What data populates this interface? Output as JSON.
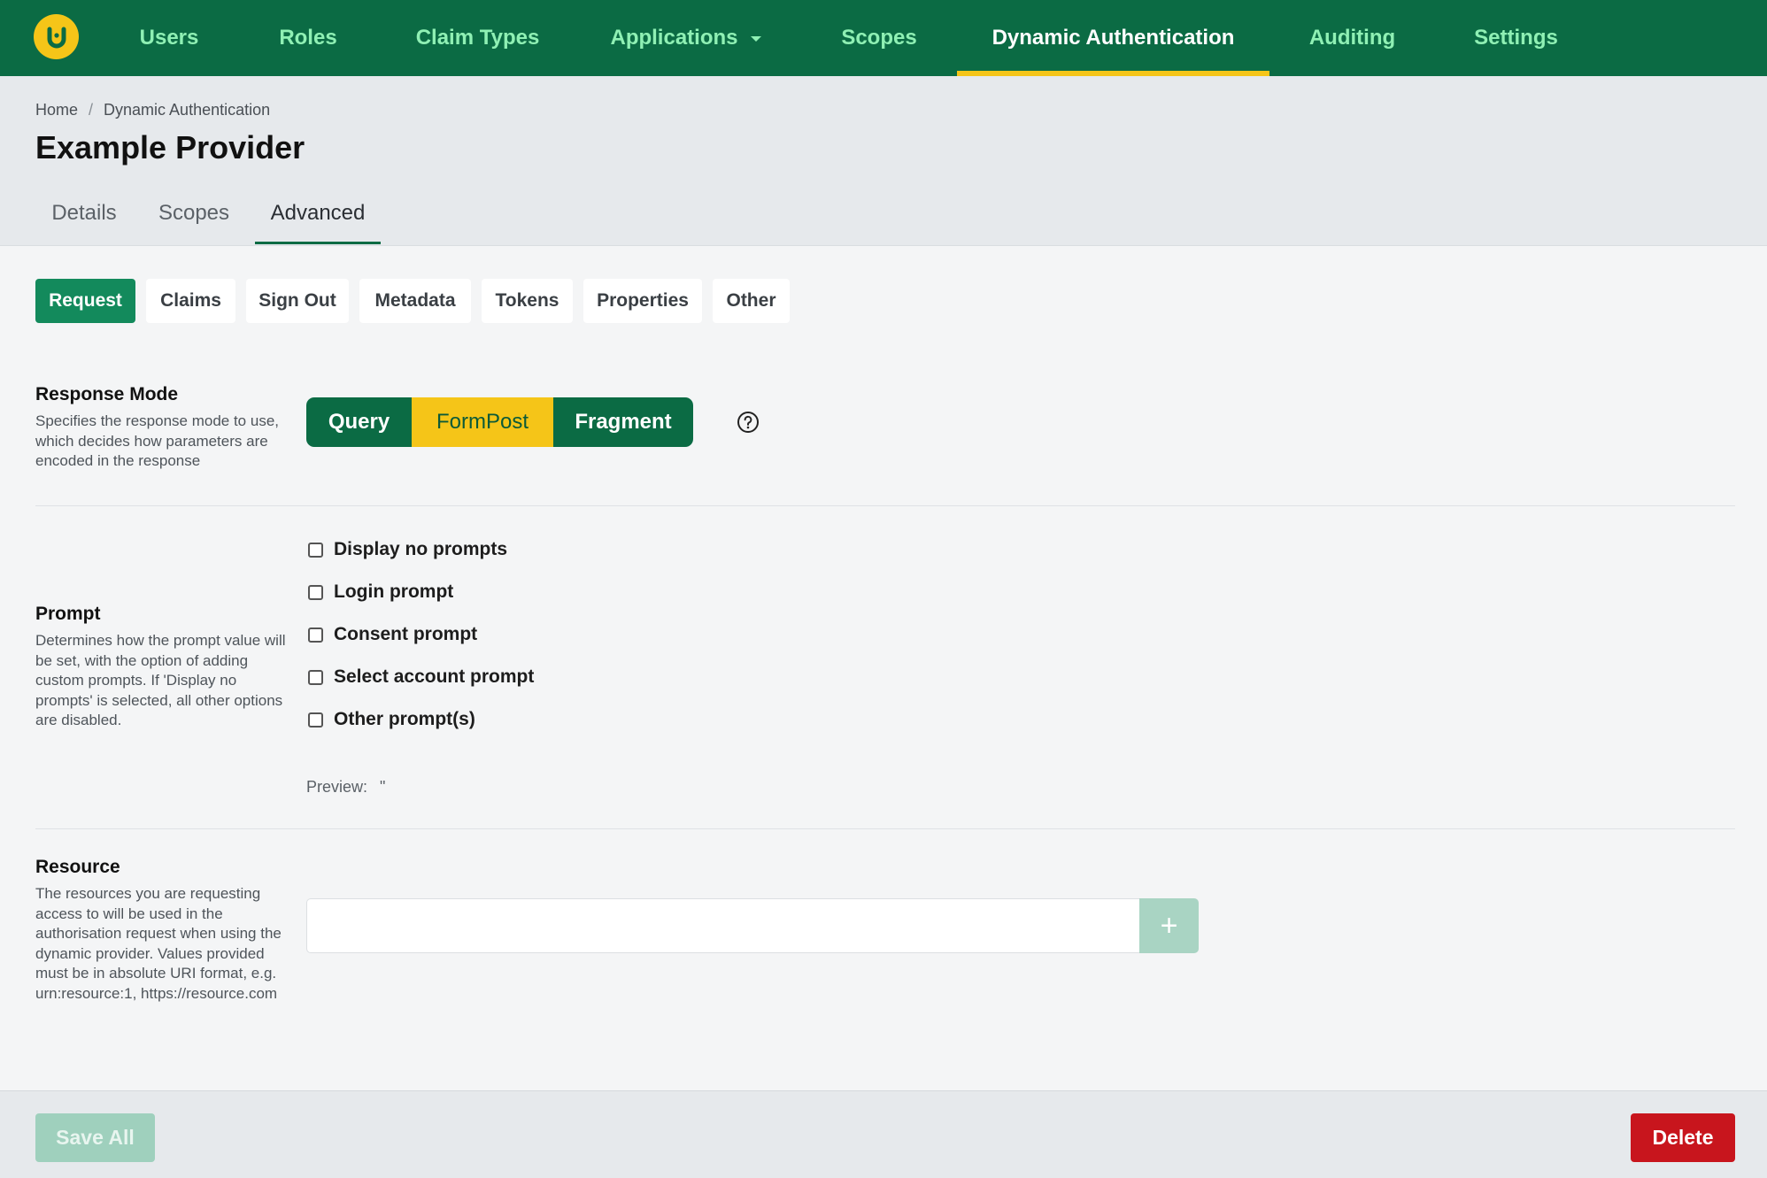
{
  "nav": {
    "logo_letter": "U",
    "items": [
      {
        "label": "Users"
      },
      {
        "label": "Roles"
      },
      {
        "label": "Claim Types"
      },
      {
        "label": "Applications"
      },
      {
        "label": "Scopes"
      },
      {
        "label": "Dynamic Authentication"
      },
      {
        "label": "Auditing"
      },
      {
        "label": "Settings"
      }
    ],
    "active_index": 5
  },
  "breadcrumb": [
    "Home",
    "Dynamic Authentication"
  ],
  "breadcrumb_separator": "/",
  "page_title": "Example Provider",
  "tabs": [
    {
      "label": "Details"
    },
    {
      "label": "Scopes"
    },
    {
      "label": "Advanced"
    }
  ],
  "active_tab": "Advanced",
  "subtabs": [
    {
      "label": "Request"
    },
    {
      "label": "Claims"
    },
    {
      "label": "Sign Out"
    },
    {
      "label": "Metadata"
    },
    {
      "label": "Tokens"
    },
    {
      "label": "Properties"
    },
    {
      "label": "Other"
    }
  ],
  "active_subtab": "Request",
  "response_mode": {
    "title": "Response Mode",
    "description": "Specifies the response mode to use, which decides how parameters are encoded in the response",
    "options": [
      {
        "label": "Query"
      },
      {
        "label": "FormPost"
      },
      {
        "label": "Fragment"
      }
    ],
    "selected": "FormPost",
    "help_icon": "question-circle-icon"
  },
  "prompt": {
    "title": "Prompt",
    "description": "Determines how the prompt value will be set, with the option of adding custom prompts. If 'Display no prompts' is selected, all other options are disabled.",
    "options": [
      {
        "label": "Display no prompts",
        "checked": false
      },
      {
        "label": "Login prompt",
        "checked": false
      },
      {
        "label": "Consent prompt",
        "checked": false
      },
      {
        "label": "Select account prompt",
        "checked": false
      },
      {
        "label": "Other prompt(s)",
        "checked": false
      }
    ],
    "preview_label": "Preview:",
    "preview_value": "\""
  },
  "resource": {
    "title": "Resource",
    "description": "The resources you are requesting access to will be used in the authorisation request when using the dynamic provider. Values provided must be in absolute URI format, e.g. urn:resource:1, https://resource.com",
    "input_value": "",
    "input_placeholder": "",
    "add_label": "+"
  },
  "footer": {
    "save_label": "Save All",
    "delete_label": "Delete"
  },
  "colors": {
    "brand_green": "#0b6b44",
    "accent_yellow": "#f5c518",
    "active_subtab": "#138a5c",
    "danger": "#c8151d"
  }
}
